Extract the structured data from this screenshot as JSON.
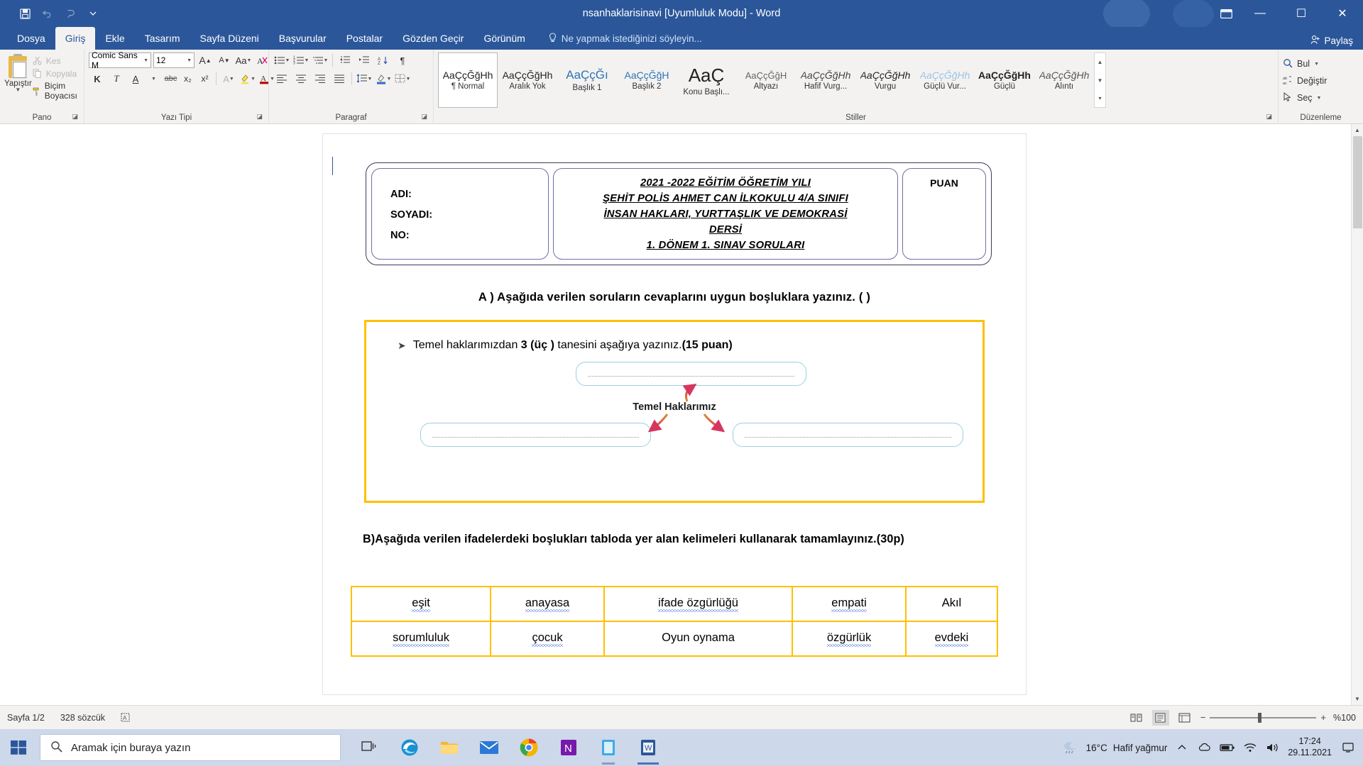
{
  "window": {
    "title": "nsanhaklarisinavi [Uyumluluk Modu] - Word",
    "qat": {
      "save": "save-icon",
      "undo": "undo-icon",
      "redo": "redo-icon",
      "customize": "customize-quick-access-icon"
    },
    "controls": {
      "ribbon_display": "ribbon-display-options",
      "minimize": "—",
      "maximize": "☐",
      "close": "✕"
    }
  },
  "tabs": [
    {
      "label": "Dosya",
      "active": false
    },
    {
      "label": "Giriş",
      "active": true
    },
    {
      "label": "Ekle",
      "active": false
    },
    {
      "label": "Tasarım",
      "active": false
    },
    {
      "label": "Sayfa Düzeni",
      "active": false
    },
    {
      "label": "Başvurular",
      "active": false
    },
    {
      "label": "Postalar",
      "active": false
    },
    {
      "label": "Gözden Geçir",
      "active": false
    },
    {
      "label": "Görünüm",
      "active": false
    }
  ],
  "tellme": {
    "placeholder": "Ne yapmak istediğinizi söyleyin..."
  },
  "share": {
    "label": "Paylaş"
  },
  "ribbon": {
    "groups": {
      "clipboard": {
        "label": "Pano",
        "paste": "Yapıştır",
        "cut": "Kes",
        "copy": "Kopyala",
        "format_painter": "Biçim Boyacısı"
      },
      "font": {
        "label": "Yazı Tipi",
        "font_name": "Comic Sans M",
        "font_size": "12",
        "grow": "A",
        "shrink": "A",
        "change_case": "Aa",
        "clear_format": "clear-formatting-icon",
        "bold": "K",
        "italic": "T",
        "underline": "A",
        "strikethrough": "abc",
        "subscript": "x₂",
        "superscript": "x²",
        "text_effects": "A",
        "highlight": "highlight-icon",
        "font_color": "A"
      },
      "paragraph": {
        "label": "Paragraf",
        "bullets": "bullet-list-icon",
        "numbering": "numbered-list-icon",
        "multilevel": "multilevel-list-icon",
        "decrease_indent": "decrease-indent-icon",
        "increase_indent": "increase-indent-icon",
        "sort": "sort-icon",
        "show_marks": "¶",
        "align_left": "align-left-icon",
        "align_center": "align-center-icon",
        "align_right": "align-right-icon",
        "justify": "justify-icon",
        "line_spacing": "line-spacing-icon",
        "shading": "shading-icon",
        "borders": "borders-icon"
      },
      "styles": {
        "label": "Stiller",
        "items": [
          {
            "preview": "AaÇçĞğHh",
            "name": "¶ Normal",
            "selected": true
          },
          {
            "preview": "AaÇçĞğHh",
            "name": "Aralık Yok",
            "selected": false
          },
          {
            "preview": "AaÇçĞı",
            "name": "Başlık 1",
            "selected": false
          },
          {
            "preview": "AaÇçĞğH",
            "name": "Başlık 2",
            "selected": false
          },
          {
            "preview": "AaÇ",
            "name": "Konu Başlı...",
            "selected": false
          },
          {
            "preview": "AaÇçĞğH",
            "name": "Altyazı",
            "selected": false
          },
          {
            "preview": "AaÇçĞğHh",
            "name": "Hafif Vurg...",
            "selected": false
          },
          {
            "preview": "AaÇçĞğHh",
            "name": "Vurgu",
            "selected": false
          },
          {
            "preview": "AaÇçĞğHh",
            "name": "Güçlü Vur...",
            "selected": false
          },
          {
            "preview": "AaÇçĞğHh",
            "name": "Güçlü",
            "selected": false
          },
          {
            "preview": "AaÇçĞğHh",
            "name": "Alıntı",
            "selected": false
          }
        ]
      },
      "editing": {
        "label": "Düzenleme",
        "find": "Bul",
        "replace": "Değiştir",
        "select": "Seç"
      }
    }
  },
  "document": {
    "header": {
      "left_fields": [
        "ADI:",
        "SOYADI:",
        "NO:"
      ],
      "center_lines": [
        "2021 -2022 EĞİTİM ÖĞRETİM YILI",
        "ŞEHİT POLİS AHMET CAN İLKOKULU 4/A SINIFI",
        "İNSAN HAKLARI, YURTTAŞLIK VE DEMOKRASİ",
        "DERSİ",
        "1. DÖNEM 1. SINAV SORULARI"
      ],
      "score_label": "PUAN"
    },
    "section_a": "A )   Aşağıda verilen soruların cevaplarını uygun boşluklara yazınız. ( )",
    "question1": {
      "bullet": "➤",
      "text_before": "Temel haklarımızdan ",
      "text_bold": "3 (üç )",
      "text_after": " tanesini aşağıya yazınız.",
      "points": "(15 puan)"
    },
    "diagram": {
      "center_label": "Temel Haklarımız",
      "blanks": [
        "",
        "",
        ""
      ]
    },
    "section_b": "B)Aşağıda verilen ifadelerdeki boşlukları tabloda yer alan kelimeleri kullanarak tamamlayınız.(30p)",
    "word_table": {
      "rows": [
        [
          {
            "text": "eşit",
            "squiggle": "blue"
          },
          {
            "text": "anayasa",
            "squiggle": "blue"
          },
          {
            "text": "ifade özgürlüğü",
            "squiggle": "blue"
          },
          {
            "text": "empati",
            "squiggle": "blue"
          },
          {
            "text": "Akıl",
            "squiggle": "none"
          }
        ],
        [
          {
            "text": "sorumluluk",
            "squiggle": "blue"
          },
          {
            "text": "çocuk",
            "squiggle": "blue"
          },
          {
            "text": "Oyun oynama",
            "squiggle": "none"
          },
          {
            "text": "özgürlük",
            "squiggle": "blue"
          },
          {
            "text": "evdeki",
            "squiggle": "blue"
          }
        ]
      ]
    }
  },
  "statusbar": {
    "page": "Sayfa 1/2",
    "words": "328 sözcük",
    "proofing": "proofing-icon",
    "views": [
      "read-mode-icon",
      "print-layout-icon",
      "web-layout-icon"
    ],
    "zoom": "%100",
    "zoom_out": "−",
    "zoom_in": "+"
  },
  "taskbar": {
    "start": "windows-start-icon",
    "search_placeholder": "Aramak için buraya yazın",
    "task_view": "task-view-icon",
    "apps": [
      {
        "name": "edge-icon"
      },
      {
        "name": "file-explorer-icon"
      },
      {
        "name": "mail-icon"
      },
      {
        "name": "chrome-icon"
      },
      {
        "name": "onenote-icon"
      },
      {
        "name": "store-icon"
      },
      {
        "name": "word-icon"
      }
    ],
    "weather_temp": "16°C",
    "weather_desc": "Hafif yağmur",
    "tray": [
      "show-hidden-icons",
      "onedrive-icon",
      "battery-icon",
      "wifi-icon",
      "volume-icon"
    ],
    "time": "17:24",
    "date": "29.11.2021",
    "show_desktop": "show-desktop-icon"
  }
}
